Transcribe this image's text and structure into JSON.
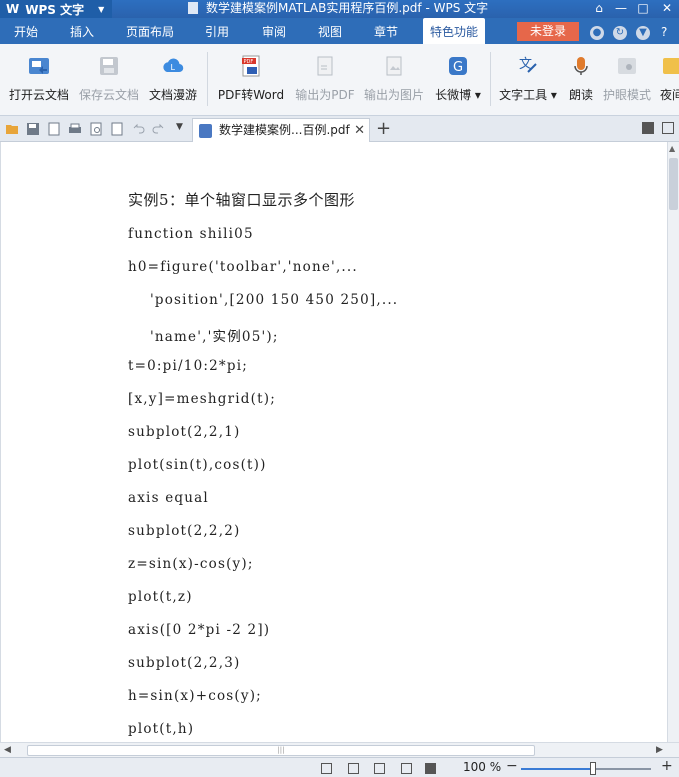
{
  "window": {
    "app_button": "WPS 文字",
    "app_logo": "W",
    "title": "数学建模案例MATLAB实用程序百例.pdf - WPS 文字",
    "controls": [
      "minimize-icon",
      "maximize-icon",
      "close-icon"
    ]
  },
  "menu": {
    "items": [
      "开始",
      "插入",
      "页面布局",
      "引用",
      "审阅",
      "视图",
      "章节",
      "特色功能"
    ],
    "active": "特色功能",
    "login_label": "未登录",
    "help_glyph": "?"
  },
  "ribbon": {
    "buttons": [
      {
        "label": "打开云文档",
        "icon": "open-cloud-icon",
        "enabled": true
      },
      {
        "label": "保存云文档",
        "icon": "save-cloud-icon",
        "enabled": false
      },
      {
        "label": "文档漫游",
        "icon": "cloud-roam-icon",
        "enabled": true
      },
      {
        "label": "PDF转Word",
        "icon": "pdf-to-word-icon",
        "enabled": true
      },
      {
        "label": "输出为PDF",
        "icon": "export-pdf-icon",
        "enabled": false
      },
      {
        "label": "输出为图片",
        "icon": "export-image-icon",
        "enabled": false
      },
      {
        "label": "长微博",
        "icon": "long-weibo-icon",
        "enabled": true
      },
      {
        "label": "文字工具",
        "icon": "text-tools-icon",
        "enabled": true
      },
      {
        "label": "朗读",
        "icon": "read-aloud-icon",
        "enabled": true
      },
      {
        "label": "护眼模式",
        "icon": "eye-care-icon",
        "enabled": false
      },
      {
        "label": "夜间",
        "icon": "night-mode-icon",
        "enabled": true
      }
    ]
  },
  "tabbar": {
    "doc_tab_title": "数学建模案例...百例.pdf",
    "close_glyph": "✕",
    "new_tab_glyph": "+"
  },
  "document": {
    "lines": [
      "实例5：单个轴窗口显示多个图形",
      "function shili05",
      "h0=figure('toolbar','none',...",
      "    'position',[200 150 450 250],...",
      "    'name','实例05');",
      "t=0:pi/10:2*pi;",
      "[x,y]=meshgrid(t);",
      "subplot(2,2,1)",
      "plot(sin(t),cos(t))",
      "axis equal",
      "subplot(2,2,2)",
      "z=sin(x)-cos(y);",
      "plot(t,z)",
      "axis([0 2*pi -2 2])",
      "subplot(2,2,3)",
      "h=sin(x)+cos(y);",
      "plot(t,h)"
    ]
  },
  "statusbar": {
    "zoom_label": "100 %",
    "zoom_fraction": 0.55,
    "minus_glyph": "−",
    "plus_glyph": "+"
  },
  "colors": {
    "title_bg": "#2a62ad",
    "menu_bg": "#2e6db8",
    "login_bg": "#e6674a",
    "ribbon_bg": "#f3f5f8"
  }
}
